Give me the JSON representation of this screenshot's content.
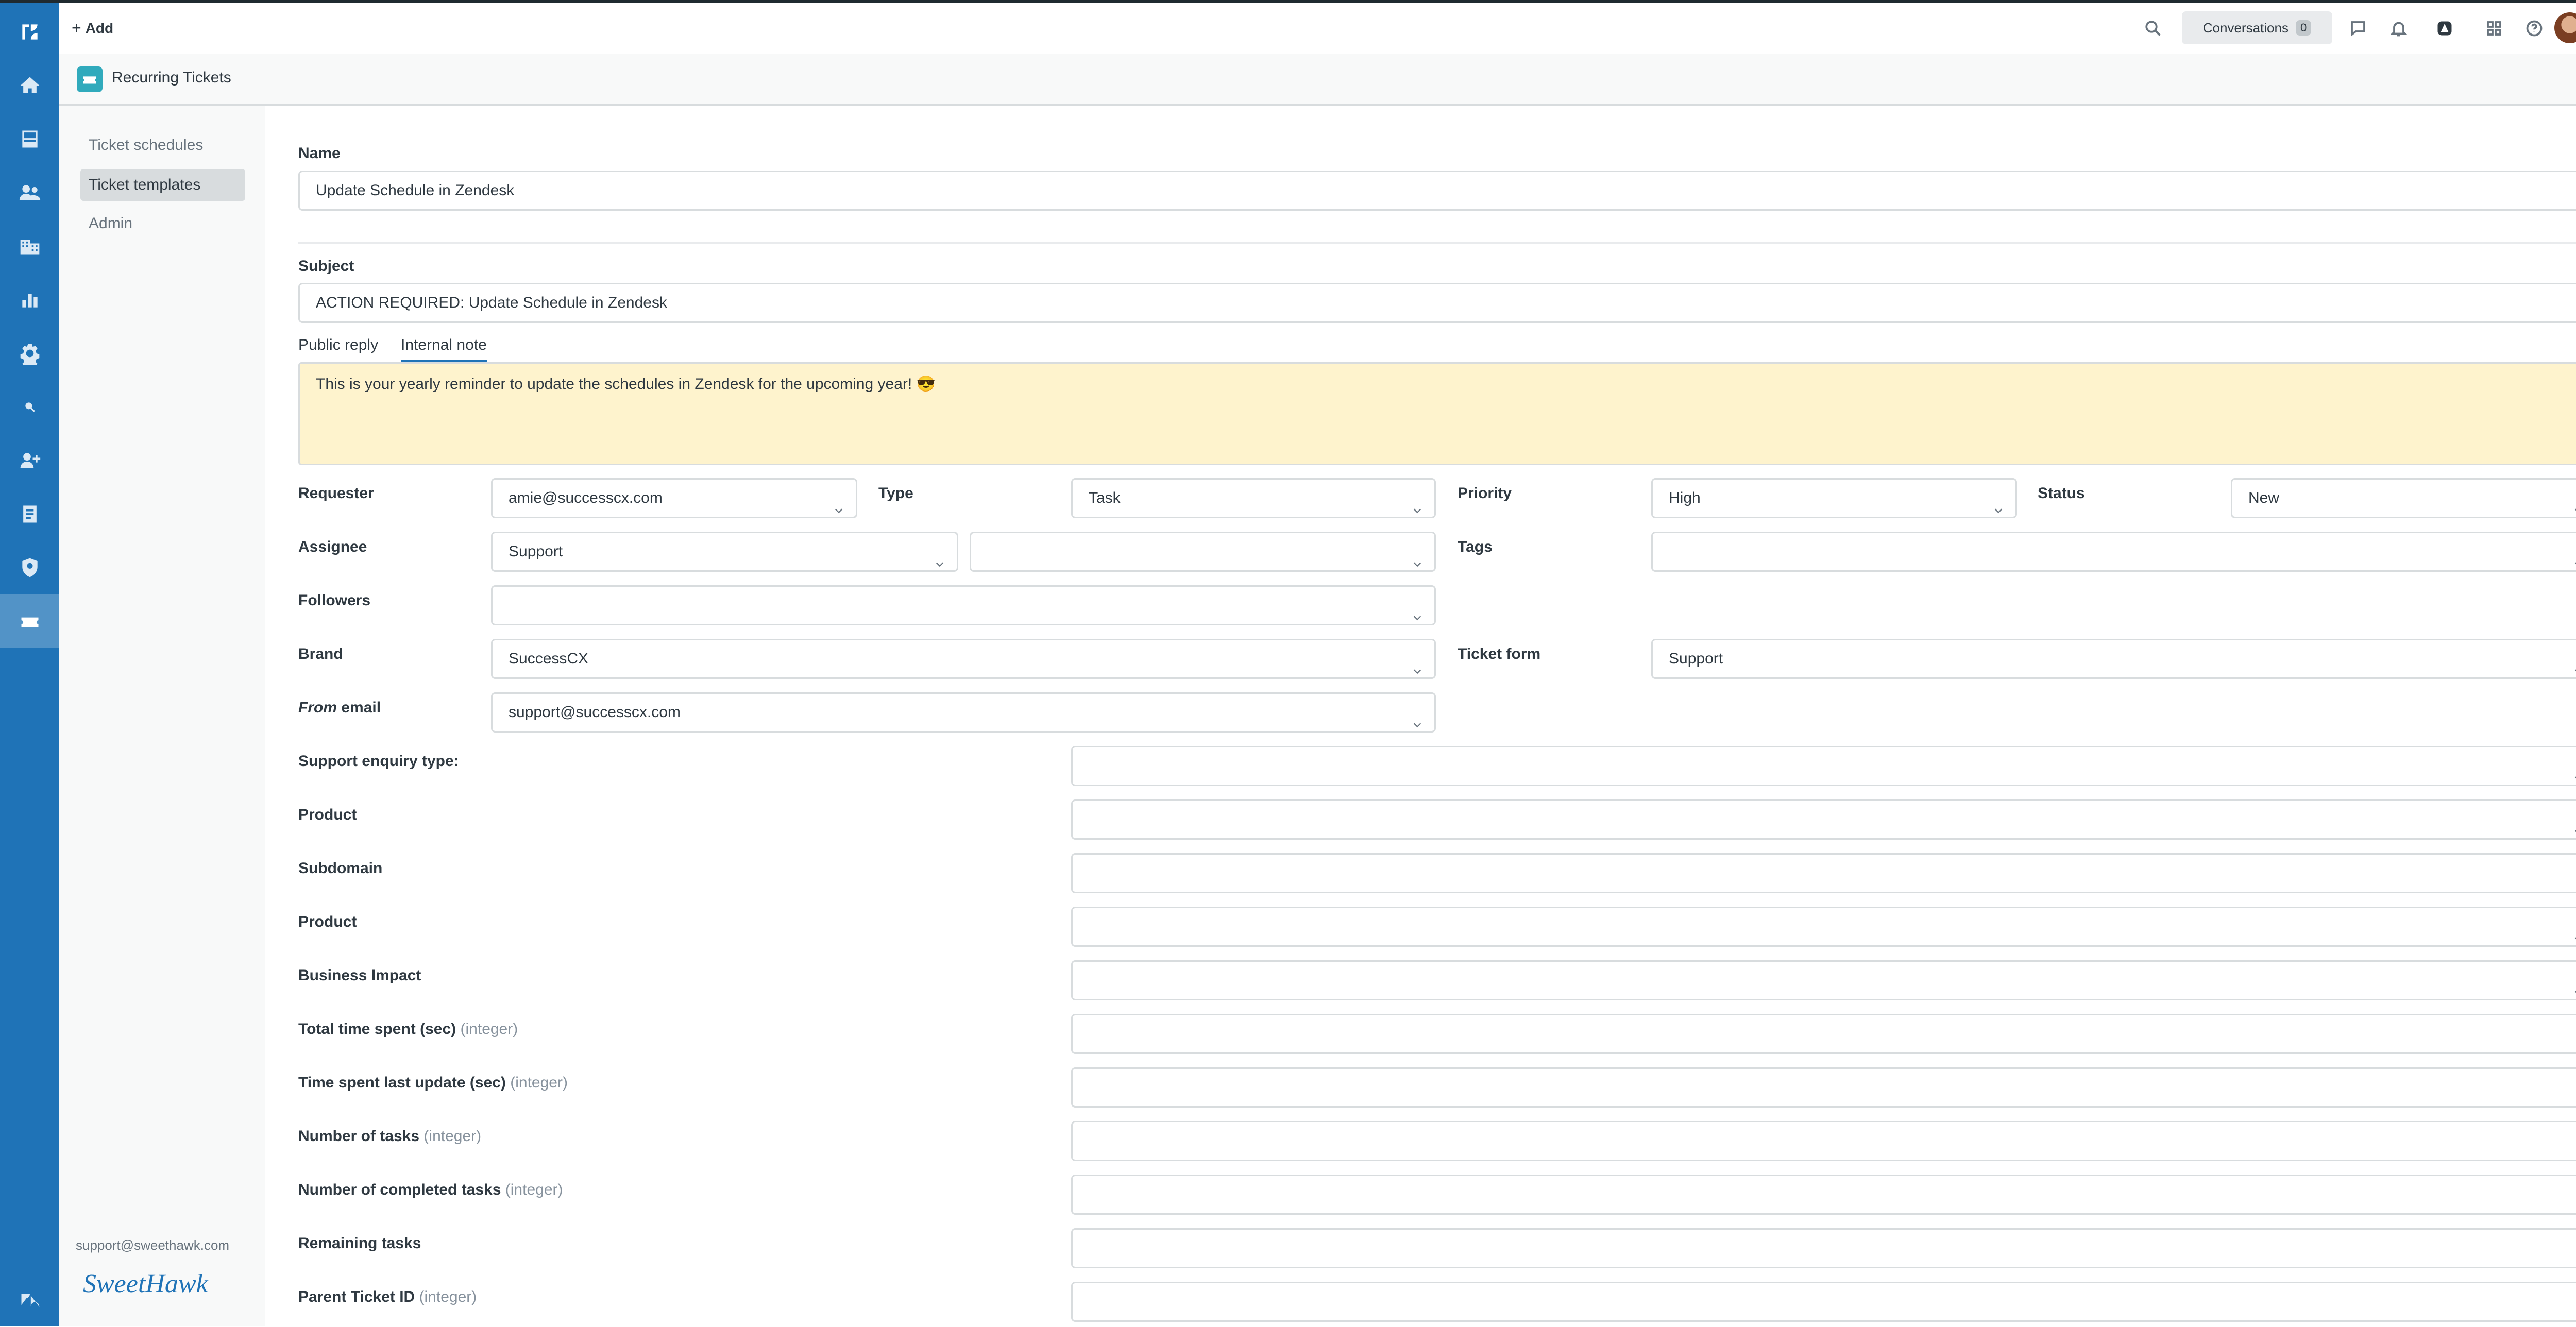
{
  "header": {
    "add_label": "Add",
    "conversations_label": "Conversations",
    "conversations_count": "0"
  },
  "app": {
    "title": "Recurring Tickets"
  },
  "subnav": {
    "items": [
      {
        "label": "Ticket schedules"
      },
      {
        "label": "Ticket templates"
      },
      {
        "label": "Admin"
      }
    ],
    "selected": "Ticket templates",
    "footer_email": "support@sweethawk.com",
    "footer_logo_text": "SweetHawk"
  },
  "form": {
    "name_label": "Name",
    "name_value": "Update Schedule in Zendesk",
    "subject_label": "Subject",
    "subject_value": "ACTION REQUIRED: Update Schedule in Zendesk",
    "tabs": [
      "Public reply",
      "Internal note"
    ],
    "active_tab": "Internal note",
    "note_text": "This is your yearly reminder to update the schedules in Zendesk for the upcoming year! 😎",
    "requester_label": "Requester",
    "requester_value": "amie@successcx.com",
    "type_label": "Type",
    "type_value": "Task",
    "priority_label": "Priority",
    "priority_value": "High",
    "status_label": "Status",
    "status_value": "New",
    "assignee_label": "Assignee",
    "assignee_value": "Support",
    "assignee_agent_value": "",
    "tags_label": "Tags",
    "tags_value": "",
    "followers_label": "Followers",
    "followers_value": "",
    "brand_label": "Brand",
    "brand_value": "SuccessCX",
    "ticket_form_label": "Ticket form",
    "ticket_form_value": "Support",
    "from_email_label_em": "From",
    "from_email_label_rest": " email",
    "from_email_value": "support@successcx.com",
    "custom_fields": [
      {
        "label": "Support enquiry type:",
        "hint": "",
        "value": ""
      },
      {
        "label": "Product",
        "hint": "",
        "value": ""
      },
      {
        "label": "Subdomain",
        "hint": "",
        "value": ""
      },
      {
        "label": "Product",
        "hint": "",
        "value": ""
      },
      {
        "label": "Business Impact",
        "hint": "",
        "value": ""
      },
      {
        "label": "Total time spent (sec)",
        "hint": "(integer)",
        "value": ""
      },
      {
        "label": "Time spent last update (sec)",
        "hint": "(integer)",
        "value": ""
      },
      {
        "label": "Number of tasks",
        "hint": "(integer)",
        "value": ""
      },
      {
        "label": "Number of completed tasks",
        "hint": "(integer)",
        "value": ""
      },
      {
        "label": "Remaining tasks",
        "hint": "",
        "value": ""
      },
      {
        "label": "Parent Ticket ID",
        "hint": "(integer)",
        "value": ""
      }
    ]
  },
  "colors": {
    "sidebar": "#1f73b7",
    "accent": "#1f73b7",
    "note_bg": "#fef3cd"
  },
  "icons": [
    "zendesk-logo-icon",
    "home-icon",
    "views-icon",
    "customers-icon",
    "organizations-icon",
    "reporting-icon",
    "admin-gear-icon",
    "search-small-icon",
    "add-user-icon",
    "knowledge-icon",
    "security-icon",
    "recurring-tickets-app-icon",
    "zendesk-footer-icon",
    "search-icon",
    "chat-icon",
    "bell-icon",
    "app-badge-icon",
    "products-grid-icon",
    "help-icon",
    "avatar"
  ]
}
